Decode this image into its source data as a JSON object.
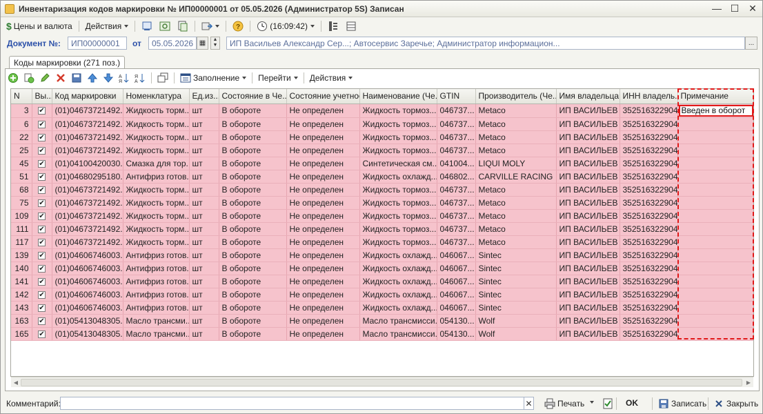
{
  "window": {
    "title": "Инвентаризация кодов маркировки № ИП00000001 от 05.05.2026 (Администратор 5S) Записан"
  },
  "toolbar": {
    "prices_label": "Цены и валюта",
    "actions_label": "Действия",
    "time_label": "(16:09:42)"
  },
  "doc": {
    "number_label": "Документ №:",
    "number_value": "ИП00000001",
    "date_label": "от",
    "date_value": "05.05.2026",
    "org_value": "ИП Васильев Александр Сер...; Автосервис Заречье; Администратор информацион..."
  },
  "tab": {
    "label": "Коды маркировки (271 поз.)"
  },
  "grid_toolbar": {
    "fill_label": "Заполнение",
    "goto_label": "Перейти",
    "actions_label": "Действия"
  },
  "table": {
    "headers": [
      "N",
      "Вы...",
      "Код маркировки",
      "Номенклатура",
      "Ед.из...",
      "Состояние в Че...",
      "Состояние учетное",
      "Наименование (Че...",
      "GTIN",
      "Производитель (Че...",
      "Имя владельца",
      "ИНН владель...",
      "Примечание"
    ],
    "rows": [
      {
        "n": "3",
        "checked": "✔",
        "code": "(01)04673721492...",
        "nom": "Жидкость торм...",
        "unit": "шт",
        "state": "В обороте",
        "acc": "Не определен",
        "name": "Жидкость тормоз...",
        "gtin": "046737...",
        "maker": "Metaco",
        "owner": "ИП ВАСИЛЬЕВ ...",
        "inn": "352516322904",
        "note": "Введен в оборот"
      },
      {
        "n": "6",
        "checked": "✔",
        "code": "(01)04673721492...",
        "nom": "Жидкость торм...",
        "unit": "шт",
        "state": "В обороте",
        "acc": "Не определен",
        "name": "Жидкость тормоз...",
        "gtin": "046737...",
        "maker": "Metaco",
        "owner": "ИП ВАСИЛЬЕВ ...",
        "inn": "352516322904",
        "note": ""
      },
      {
        "n": "22",
        "checked": "✔",
        "code": "(01)04673721492...",
        "nom": "Жидкость торм...",
        "unit": "шт",
        "state": "В обороте",
        "acc": "Не определен",
        "name": "Жидкость тормоз...",
        "gtin": "046737...",
        "maker": "Metaco",
        "owner": "ИП ВАСИЛЬЕВ ...",
        "inn": "352516322904",
        "note": ""
      },
      {
        "n": "25",
        "checked": "✔",
        "code": "(01)04673721492...",
        "nom": "Жидкость торм...",
        "unit": "шт",
        "state": "В обороте",
        "acc": "Не определен",
        "name": "Жидкость тормоз...",
        "gtin": "046737...",
        "maker": "Metaco",
        "owner": "ИП ВАСИЛЬЕВ ...",
        "inn": "352516322904",
        "note": ""
      },
      {
        "n": "45",
        "checked": "✔",
        "code": "(01)04100420030...",
        "nom": "Смазка для тор...",
        "unit": "шт",
        "state": "В обороте",
        "acc": "Не определен",
        "name": "Синтетическая см...",
        "gtin": "041004...",
        "maker": "LIQUI MOLY",
        "owner": "ИП ВАСИЛЬЕВ ...",
        "inn": "352516322904",
        "note": ""
      },
      {
        "n": "51",
        "checked": "✔",
        "code": "(01)04680295180...",
        "nom": "Антифриз готов...",
        "unit": "шт",
        "state": "В обороте",
        "acc": "Не определен",
        "name": "Жидкость охлажд...",
        "gtin": "046802...",
        "maker": "CARVILLE RACING",
        "owner": "ИП ВАСИЛЬЕВ ...",
        "inn": "352516322904",
        "note": ""
      },
      {
        "n": "68",
        "checked": "✔",
        "code": "(01)04673721492...",
        "nom": "Жидкость торм...",
        "unit": "шт",
        "state": "В обороте",
        "acc": "Не определен",
        "name": "Жидкость тормоз...",
        "gtin": "046737...",
        "maker": "Metaco",
        "owner": "ИП ВАСИЛЬЕВ ...",
        "inn": "352516322904",
        "note": ""
      },
      {
        "n": "75",
        "checked": "✔",
        "code": "(01)04673721492...",
        "nom": "Жидкость торм...",
        "unit": "шт",
        "state": "В обороте",
        "acc": "Не определен",
        "name": "Жидкость тормоз...",
        "gtin": "046737...",
        "maker": "Metaco",
        "owner": "ИП ВАСИЛЬЕВ ...",
        "inn": "352516322904",
        "note": ""
      },
      {
        "n": "109",
        "checked": "✔",
        "code": "(01)04673721492...",
        "nom": "Жидкость торм...",
        "unit": "шт",
        "state": "В обороте",
        "acc": "Не определен",
        "name": "Жидкость тормоз...",
        "gtin": "046737...",
        "maker": "Metaco",
        "owner": "ИП ВАСИЛЬЕВ ...",
        "inn": "352516322904",
        "note": ""
      },
      {
        "n": "111",
        "checked": "✔",
        "code": "(01)04673721492...",
        "nom": "Жидкость торм...",
        "unit": "шт",
        "state": "В обороте",
        "acc": "Не определен",
        "name": "Жидкость тормоз...",
        "gtin": "046737...",
        "maker": "Metaco",
        "owner": "ИП ВАСИЛЬЕВ ...",
        "inn": "352516322904",
        "note": ""
      },
      {
        "n": "117",
        "checked": "✔",
        "code": "(01)04673721492...",
        "nom": "Жидкость торм...",
        "unit": "шт",
        "state": "В обороте",
        "acc": "Не определен",
        "name": "Жидкость тормоз...",
        "gtin": "046737...",
        "maker": "Metaco",
        "owner": "ИП ВАСИЛЬЕВ ...",
        "inn": "352516322904",
        "note": ""
      },
      {
        "n": "139",
        "checked": "✔",
        "code": "(01)04606746003...",
        "nom": "Антифриз готов...",
        "unit": "шт",
        "state": "В обороте",
        "acc": "Не определен",
        "name": "Жидкость охлажд...",
        "gtin": "046067...",
        "maker": "Sintec",
        "owner": "ИП ВАСИЛЬЕВ ...",
        "inn": "352516322904",
        "note": ""
      },
      {
        "n": "140",
        "checked": "✔",
        "code": "(01)04606746003...",
        "nom": "Антифриз готов...",
        "unit": "шт",
        "state": "В обороте",
        "acc": "Не определен",
        "name": "Жидкость охлажд...",
        "gtin": "046067...",
        "maker": "Sintec",
        "owner": "ИП ВАСИЛЬЕВ ...",
        "inn": "352516322904",
        "note": ""
      },
      {
        "n": "141",
        "checked": "✔",
        "code": "(01)04606746003...",
        "nom": "Антифриз готов...",
        "unit": "шт",
        "state": "В обороте",
        "acc": "Не определен",
        "name": "Жидкость охлажд...",
        "gtin": "046067...",
        "maker": "Sintec",
        "owner": "ИП ВАСИЛЬЕВ ...",
        "inn": "352516322904",
        "note": ""
      },
      {
        "n": "142",
        "checked": "✔",
        "code": "(01)04606746003...",
        "nom": "Антифриз готов...",
        "unit": "шт",
        "state": "В обороте",
        "acc": "Не определен",
        "name": "Жидкость охлажд...",
        "gtin": "046067...",
        "maker": "Sintec",
        "owner": "ИП ВАСИЛЬЕВ ...",
        "inn": "352516322904",
        "note": ""
      },
      {
        "n": "143",
        "checked": "✔",
        "code": "(01)04606746003...",
        "nom": "Антифриз готов...",
        "unit": "шт",
        "state": "В обороте",
        "acc": "Не определен",
        "name": "Жидкость охлажд...",
        "gtin": "046067...",
        "maker": "Sintec",
        "owner": "ИП ВАСИЛЬЕВ ...",
        "inn": "352516322904",
        "note": ""
      },
      {
        "n": "163",
        "checked": "✔",
        "code": "(01)05413048305...",
        "nom": "Масло трансми...",
        "unit": "шт",
        "state": "В обороте",
        "acc": "Не определен",
        "name": "Масло трансмисси...",
        "gtin": "054130...",
        "maker": "Wolf",
        "owner": "ИП ВАСИЛЬЕВ ...",
        "inn": "352516322904",
        "note": ""
      },
      {
        "n": "165",
        "checked": "✔",
        "code": "(01)05413048305...",
        "nom": "Масло трансми...",
        "unit": "шт",
        "state": "В обороте",
        "acc": "Не определен",
        "name": "Масло трансмисси...",
        "gtin": "054130...",
        "maker": "Wolf",
        "owner": "ИП ВАСИЛЬЕВ ...",
        "inn": "352516322904",
        "note": ""
      }
    ]
  },
  "footer": {
    "comment_label": "Комментарий:",
    "print_label": "Печать",
    "ok_label": "OK",
    "save_label": "Записать",
    "close_label": "Закрыть"
  },
  "colors": {
    "row_highlight": "#f6c3cc",
    "annotation": "#e11919",
    "label_blue": "#2a4fa8"
  }
}
